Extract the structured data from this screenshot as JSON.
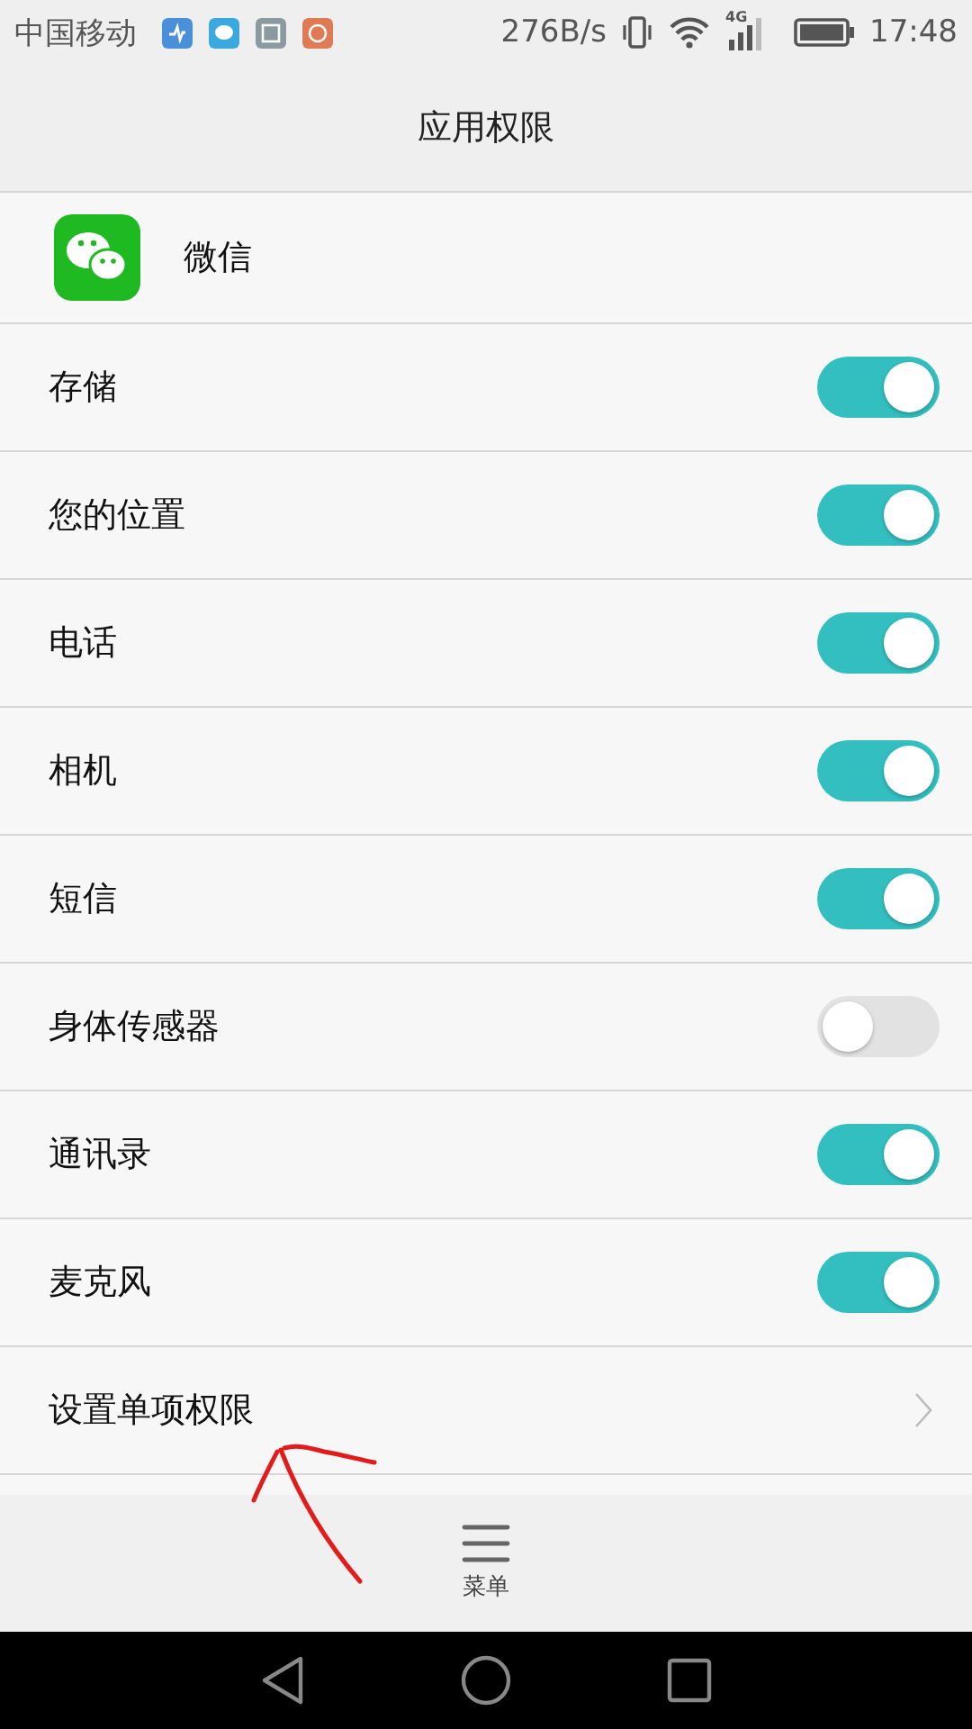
{
  "status_bar": {
    "carrier": "中国移动",
    "speed": "276B/s",
    "network_type": "4G",
    "time": "17:48"
  },
  "header": {
    "title": "应用权限"
  },
  "app": {
    "name": "微信"
  },
  "permissions": [
    {
      "label": "存储",
      "on": true
    },
    {
      "label": "您的位置",
      "on": true
    },
    {
      "label": "电话",
      "on": true
    },
    {
      "label": "相机",
      "on": true
    },
    {
      "label": "短信",
      "on": true
    },
    {
      "label": "身体传感器",
      "on": false
    },
    {
      "label": "通讯录",
      "on": true
    },
    {
      "label": "麦克风",
      "on": true
    }
  ],
  "link_row": {
    "label": "设置单项权限"
  },
  "bottom_bar": {
    "menu_label": "菜单"
  }
}
